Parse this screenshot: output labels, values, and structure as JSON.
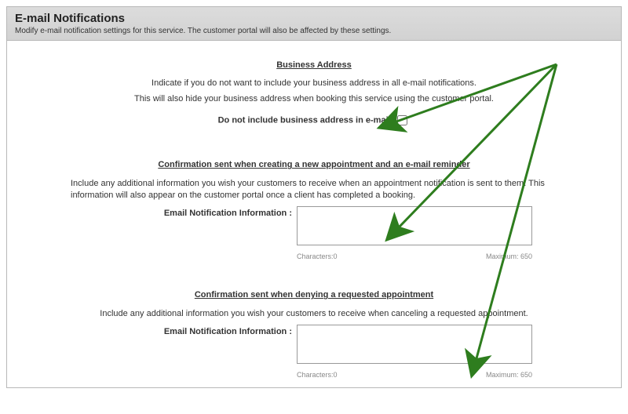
{
  "header": {
    "title": "E-mail Notifications",
    "subtitle": "Modify e-mail notification settings for this service. The customer portal will also be affected by these settings."
  },
  "section_addr": {
    "heading": "Business Address",
    "line1": "Indicate if you do not want to include your business address in all e-mail notifications.",
    "line2": "This will also hide your business address when booking this service using the customer portal.",
    "checkbox_label": "Do not include business address in e-mail:",
    "checked": false
  },
  "section_confirm": {
    "heading": "Confirmation sent when creating a new appointment and an e-mail reminder",
    "desc": "Include any additional information you wish your customers to receive when an appointment notification is sent to them. This information will also appear on the customer portal once a client has completed a booking.",
    "field_label": "Email Notification Information :",
    "value": "",
    "char_count_label": "Characters:0",
    "max_label": "Maximum:  650"
  },
  "section_deny": {
    "heading": "Confirmation sent when denying a requested appointment",
    "desc": "Include any additional information you wish your customers to receive when canceling a requested appointment.",
    "field_label": "Email Notification Information :",
    "value": "",
    "char_count_label": "Characters:0",
    "max_label": "Maximum:  650"
  },
  "annotation": {
    "color": "#2e7d1e"
  }
}
